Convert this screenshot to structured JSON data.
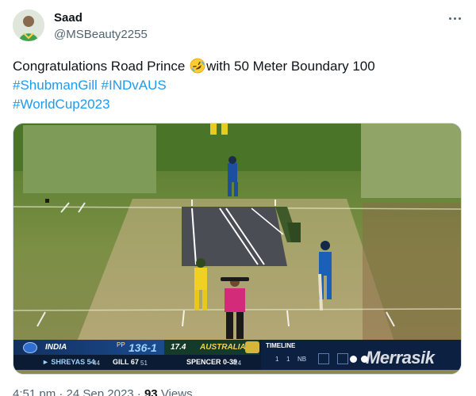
{
  "author": {
    "name": "Saad",
    "handle": "@MSBeauty2255",
    "avatar_icon": "profile-avatar"
  },
  "more_icon": "more-horizontal-icon",
  "tweet": {
    "text_before_emoji": "Congratulations Road Prince ",
    "emoji": "rolling-on-floor-laughing-emoji",
    "text_after_emoji": "with 50 Meter Boundary  100",
    "hashtags_line1": [
      "#ShubmanGill",
      "#INDvAUS"
    ],
    "hashtags_line2": [
      "#WorldCup2023"
    ]
  },
  "media": {
    "scorebar": {
      "team1": "INDIA",
      "score": "136-1",
      "overs": "17.4",
      "team2": "AUSTRALIA",
      "batter1": "► SHREYAS 54",
      "batter1_balls": "44",
      "batter2": "GILL 67",
      "batter2_balls": "51",
      "bowler": "SPENCER 0-39",
      "bowler_overs": "4.4",
      "timeline_label": "TIMELINE",
      "timeline_balls": [
        "1",
        "1",
        "NB"
      ],
      "watermark": "Merrasik"
    }
  },
  "meta": {
    "time": "4:51 pm",
    "separator": " · ",
    "date": "24 Sep 2023",
    "views_count": "93",
    "views_label": "Views"
  },
  "colors": {
    "hashtag": "#1d9bf0",
    "text": "#0f1419",
    "secondary": "#536471",
    "border": "#cfd9de"
  }
}
